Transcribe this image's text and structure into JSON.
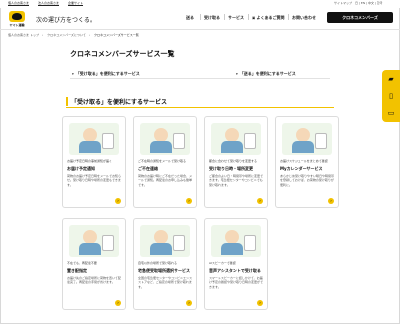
{
  "utility": {
    "links": [
      "個人のお客さま",
      "法人のお客さま",
      "企業サイト"
    ],
    "lang": "サイトマップ　日 | EN | 中文 | 한국"
  },
  "header": {
    "logo_text": "ヤマト運輸",
    "tagline": "次の運び方をつくる。",
    "nav": [
      "送る",
      "受け取る",
      "サービス",
      "よくあるご質問",
      "お問い合わせ"
    ],
    "member_button": "クロネコメンバーズ"
  },
  "breadcrumb": [
    "個人のお客さま トップ",
    "クロネコメンバーズについて",
    "クロネコメンバーズサービス一覧"
  ],
  "page": {
    "title": "クロネコメンバーズサービス一覧",
    "sub_link_receive": "「受け取る」を便利にするサービス",
    "sub_link_send": "「送る」を便利にするサービス"
  },
  "section": {
    "title": "「受け取る」を便利にするサービス"
  },
  "cards": [
    {
      "kicker": "お届け予定日時の事前通知が届く",
      "title": "お届け予定通知",
      "desc": "荷物のお届け予定日時をメールでお知らせ。受け取り日時や場所の変更もできます。"
    },
    {
      "kicker": "ご不在時の通知をメールで受け取る",
      "title": "ご不在連絡",
      "desc": "荷物のお届け時にご不在だった場合、メールで通知。再配達のお申し込みも簡単です。"
    },
    {
      "kicker": "都合に合わせて受け取りを変更する",
      "title": "受け取り日時・場所変更",
      "desc": "ご都合のよい日・時間帯や場所に変更できます。宅急便センターやコンビニでも受け取れます。"
    },
    {
      "kicker": "お届けスケジュールをまとめて確認",
      "title": "Myカレンダーサービス",
      "desc": "あらかじめ受け取りやすい曜日や時間帯を登録しておけば、お荷物の受け取りが便利に。"
    },
    {
      "kicker": "不在でも、再配達不要",
      "title": "置き配指定",
      "desc": "お届け先のご指定場所に荷物を置いて配達完了。再配達の手間が省けます。"
    },
    {
      "kicker": "自宅以外の場所で受け取れる",
      "title": "宅急便受取場所選択サービス",
      "desc": "全国の宅急便センターやコンビニエンスストアなど、ご指定の場所で受け取れます。"
    },
    {
      "kicker": "AIスピーカーで確認",
      "title": "音声アシスタントで受け取る",
      "desc": "スマートスピーカーに話しかけて、お届け予定の確認や受け取り日時の変更ができます。"
    }
  ],
  "side_buttons": [
    "truck-icon",
    "phone-icon",
    "laptop-icon"
  ],
  "colors": {
    "brand_yellow": "#f2c200",
    "brand_black": "#111111"
  }
}
